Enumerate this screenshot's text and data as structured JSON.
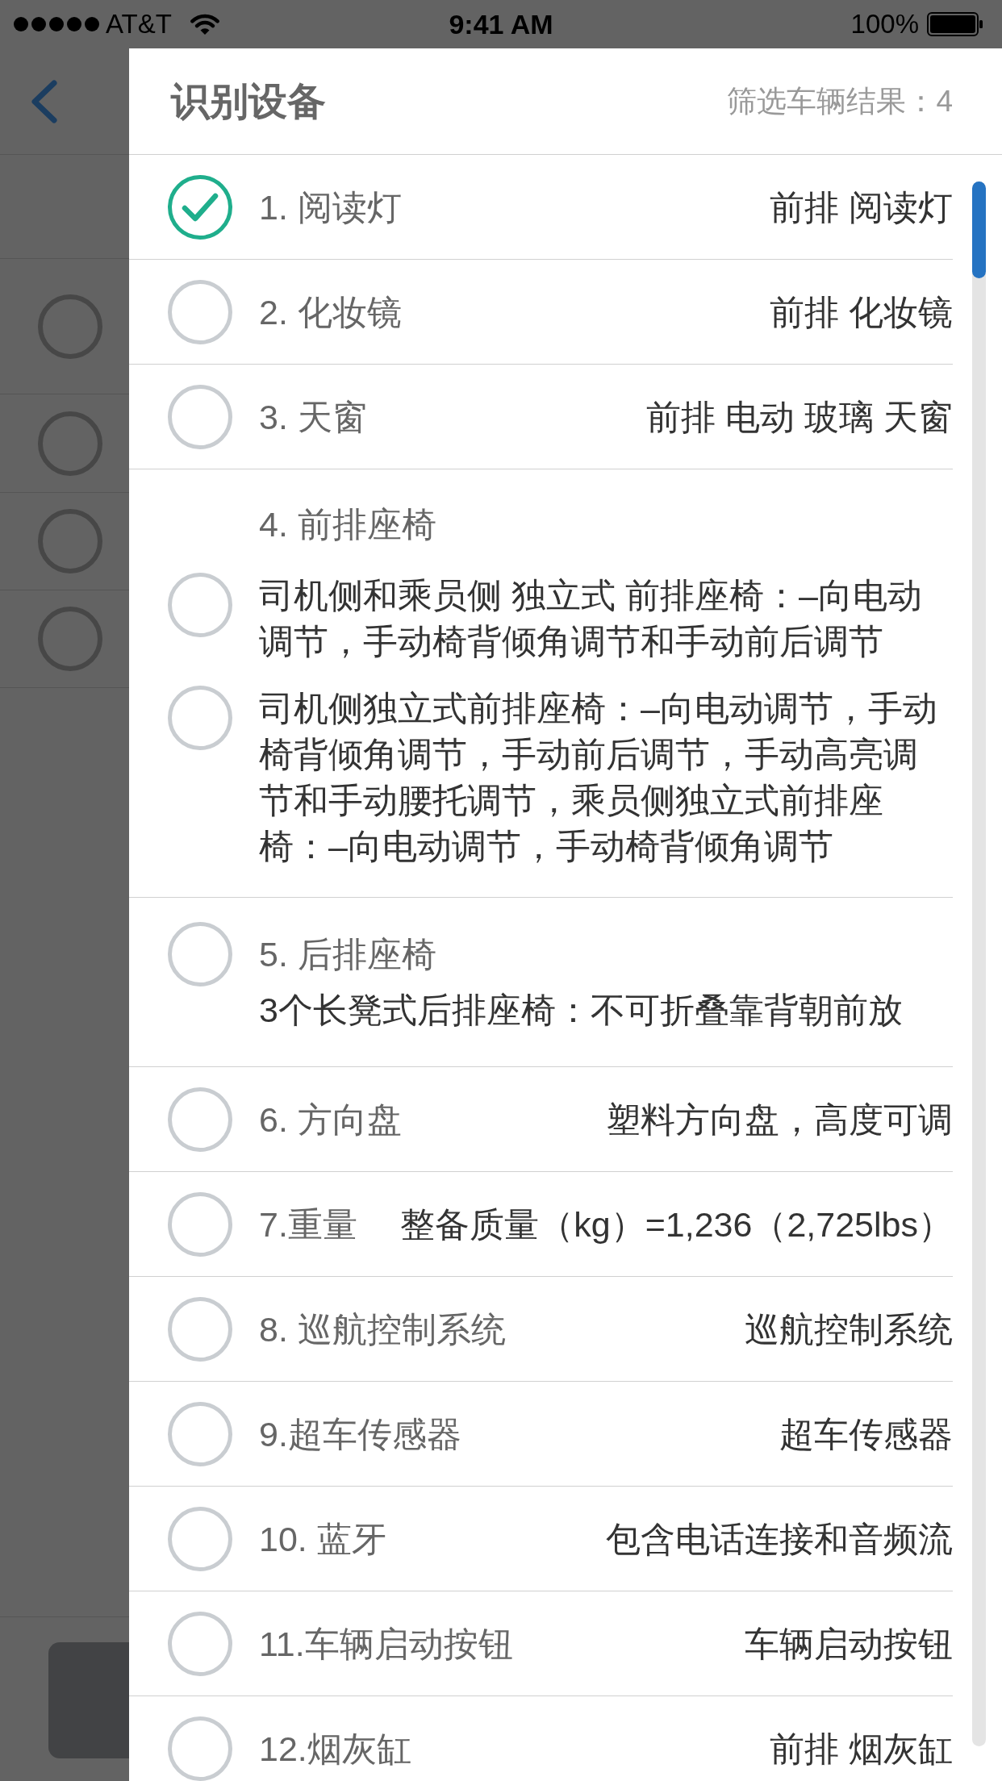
{
  "status_bar": {
    "carrier": "AT&T",
    "time": "9:41 AM",
    "battery": "100%"
  },
  "background_page": {
    "rows": [
      {
        "checked": false
      },
      {
        "checked": false
      },
      {
        "checked": false
      },
      {
        "checked": false
      }
    ]
  },
  "drawer": {
    "title": "识别设备",
    "result_count": "筛选车辆结果：4",
    "items": [
      {
        "kind": "single",
        "label": "1. 阅读灯",
        "value": "前排 阅读灯",
        "checked": true
      },
      {
        "kind": "single",
        "label": "2. 化妆镜",
        "value": "前排 化妆镜",
        "checked": false
      },
      {
        "kind": "single",
        "label": "3. 天窗",
        "value": "前排 电动 玻璃 天窗",
        "checked": false
      },
      {
        "kind": "group",
        "label": "4. 前排座椅",
        "options": [
          {
            "text": "司机侧和乘员侧 独立式 前排座椅：–向电动调节，手动椅背倾角调节和手动前后调节",
            "checked": false
          },
          {
            "text": "司机侧独立式前排座椅：–向电动调节，手动椅背倾角调节，手动前后调节，手动高亮调节和手动腰托调节，乘员侧独立式前排座椅：–向电动调节，手动椅背倾角调节",
            "checked": false
          }
        ]
      },
      {
        "kind": "described",
        "label": "5. 后排座椅",
        "description": "3个长凳式后排座椅：不可折叠靠背朝前放",
        "checked": false
      },
      {
        "kind": "single",
        "label": "6. 方向盘",
        "value": "塑料方向盘，高度可调",
        "checked": false
      },
      {
        "kind": "single",
        "label": "7.重量",
        "value": "整备质量（kg）=1,236（2,725lbs）",
        "checked": false
      },
      {
        "kind": "single",
        "label": "8. 巡航控制系统",
        "value": "巡航控制系统",
        "checked": false
      },
      {
        "kind": "single",
        "label": "9.超车传感器",
        "value": "超车传感器",
        "checked": false
      },
      {
        "kind": "single",
        "label": "10. 蓝牙",
        "value": "包含电话连接和音频流",
        "checked": false
      },
      {
        "kind": "single",
        "label": "11.车辆启动按钮",
        "value": "车辆启动按钮",
        "checked": false
      },
      {
        "kind": "single",
        "label": "12.烟灰缸",
        "value": "前排 烟灰缸",
        "checked": false
      }
    ]
  }
}
